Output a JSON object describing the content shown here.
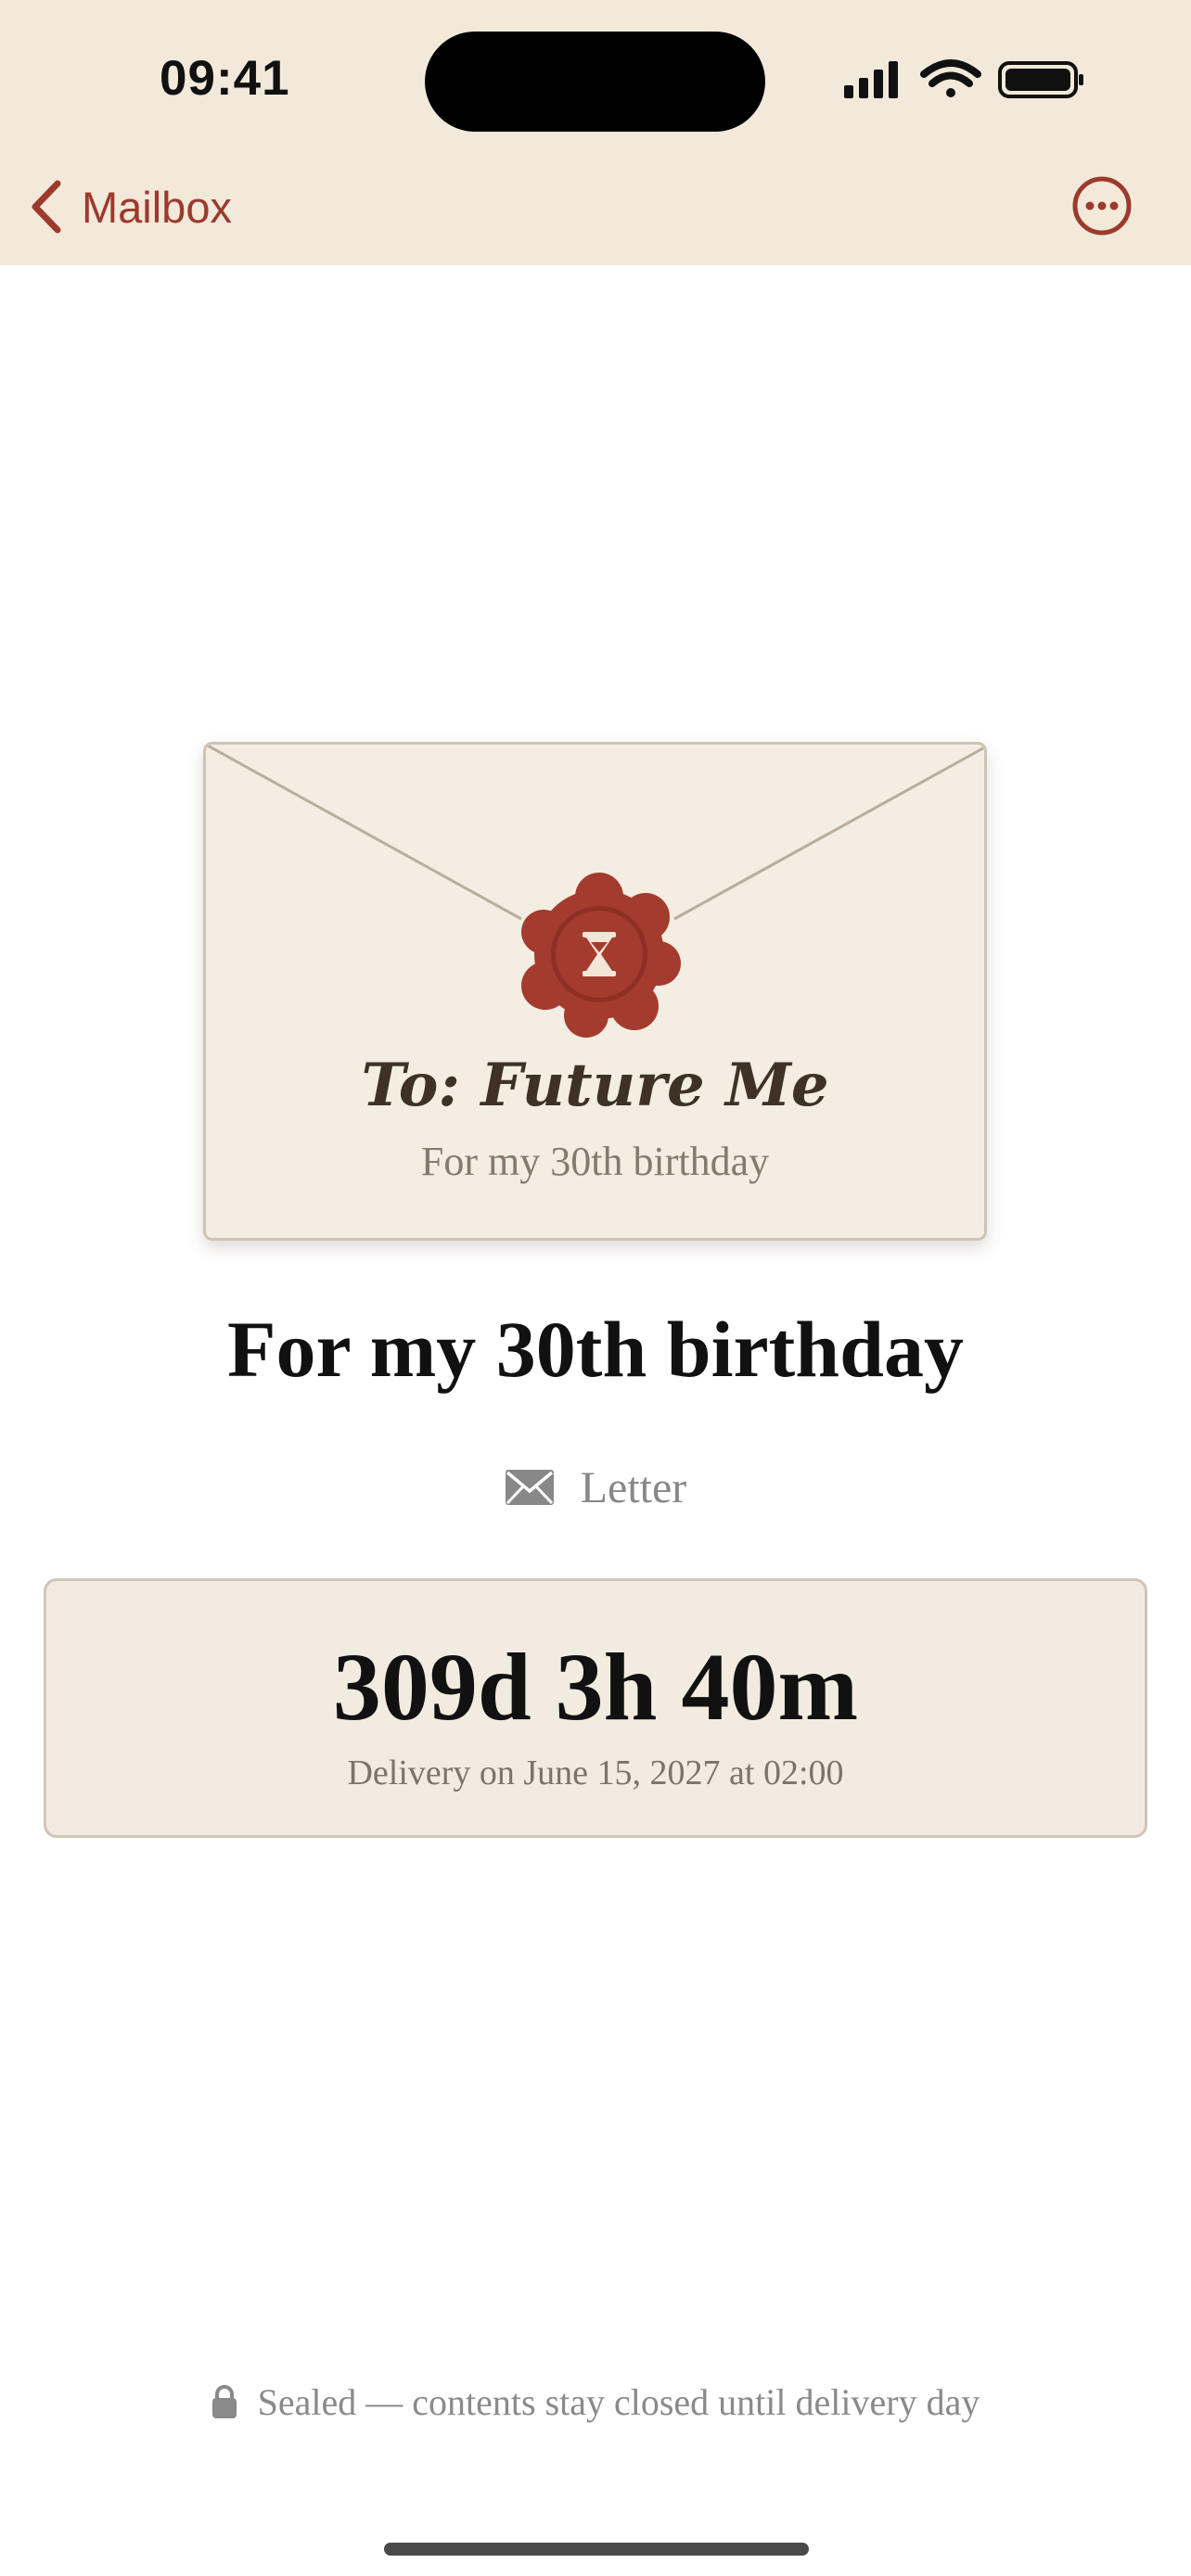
{
  "status_bar": {
    "time": "09:41",
    "icons": [
      "signal-icon",
      "wifi-icon",
      "battery-icon"
    ]
  },
  "nav": {
    "back_label": "Mailbox",
    "back_icon": "chevron-left-icon",
    "more_icon": "ellipsis-circle-icon"
  },
  "envelope": {
    "to_line": "To: Future Me",
    "subtitle": "For my 30th birthday",
    "seal_icon": "hourglass-icon"
  },
  "letter": {
    "title": "For my 30th birthday",
    "type_icon": "envelope-icon",
    "type_label": "Letter"
  },
  "countdown": {
    "value": "309d 3h 40m",
    "delivery_text": "Delivery on June 15, 2027 at 02:00"
  },
  "footer": {
    "lock_icon": "lock-icon",
    "note": "Sealed — contents stay closed until delivery day"
  },
  "colors": {
    "accent": "#9c3a2c",
    "header_bg": "#f2e9da",
    "card_bg": "#f2ebdf",
    "seal": "#a33b2e"
  }
}
